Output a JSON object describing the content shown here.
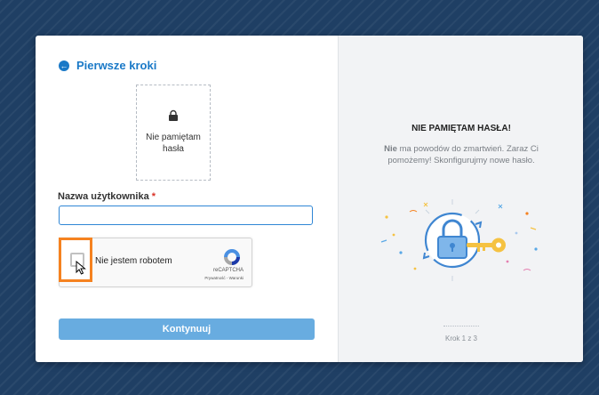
{
  "back": {
    "label": "Pierwsze kroki",
    "icon": "arrow-left-icon"
  },
  "option_tile": {
    "text": "Nie pamiętam hasła",
    "icon": "lock-icon"
  },
  "username": {
    "label": "Nazwa użytkownika",
    "required_mark": "*",
    "value": ""
  },
  "captcha": {
    "label": "Nie jestem robotem",
    "brand": "reCAPTCHA",
    "links": "Prywatność - Warunki"
  },
  "continue_label": "Kontynuuj",
  "info": {
    "title": "NIE PAMIĘTAM HASŁA!",
    "desc_strong": "Nie",
    "desc_rest": " ma powodów do zmartwień. Zaraz Ci pomożemy! Skonfigurujmy nowe hasło."
  },
  "step": "Krok 1 z 3",
  "colors": {
    "accent": "#1a79c7",
    "button": "#68ace0",
    "highlight": "#f58220",
    "background": "#1f3f64"
  }
}
